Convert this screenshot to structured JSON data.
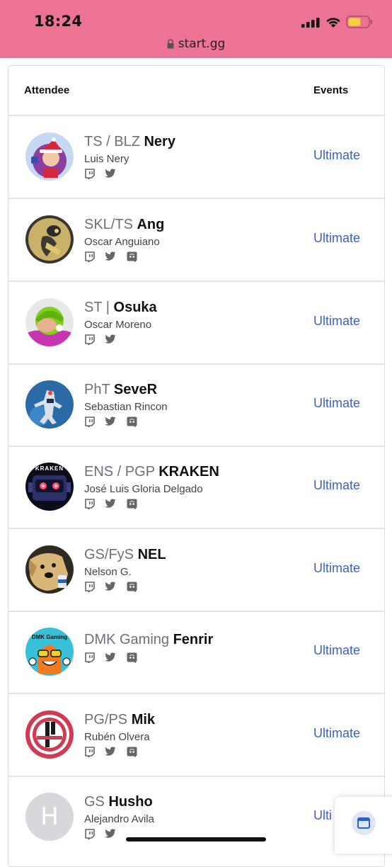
{
  "status_bar": {
    "time": "18:24",
    "url": "start.gg",
    "colors": {
      "background": "#ec7393",
      "battery": "#f5d037"
    }
  },
  "table": {
    "header": {
      "attendee": "Attendee",
      "events": "Events"
    },
    "rows": [
      {
        "prefix": "TS / BLZ",
        "tag": "Nery",
        "name": "Luis Nery",
        "socials": [
          "twitch-icon",
          "twitter-icon"
        ],
        "event": "Ultimate",
        "avatar": "avatar-santa-character"
      },
      {
        "prefix": "SKL/TS",
        "tag": "Ang",
        "name": "Oscar Anguiano",
        "socials": [
          "twitch-icon",
          "twitter-icon",
          "discord-icon"
        ],
        "event": "Ultimate",
        "avatar": "avatar-yellow-figure"
      },
      {
        "prefix": "ST |",
        "tag": "Osuka",
        "name": "Oscar Moreno",
        "socials": [
          "twitch-icon",
          "twitter-icon"
        ],
        "event": "Ultimate",
        "avatar": "avatar-green-hood"
      },
      {
        "prefix": "PhT",
        "tag": "SeveR",
        "name": "Sebastian Rincon",
        "socials": [
          "twitch-icon",
          "twitter-icon",
          "discord-icon"
        ],
        "event": "Ultimate",
        "avatar": "avatar-blue-mecha"
      },
      {
        "prefix": "ENS / PGP",
        "tag": "KRAKEN",
        "name": "José Luis Gloria Delgado",
        "socials": [
          "twitch-icon",
          "twitter-icon",
          "discord-icon"
        ],
        "event": "Ultimate",
        "avatar": "avatar-kraken-robot",
        "avatar_text": "KRAKEN"
      },
      {
        "prefix": "GS/FyS",
        "tag": "NEL",
        "name": "Nelson G.",
        "socials": [
          "twitch-icon",
          "twitter-icon",
          "discord-icon"
        ],
        "event": "Ultimate",
        "avatar": "avatar-dog"
      },
      {
        "prefix": "DMK Gaming",
        "tag": "Fenrir",
        "name": "",
        "socials": [
          "twitch-icon",
          "twitter-icon",
          "discord-icon"
        ],
        "event": "Ultimate",
        "avatar": "avatar-dmk-gaming",
        "avatar_text": "DMK Gaming"
      },
      {
        "prefix": "PG/PS",
        "tag": "Mik",
        "name": "Rubén Olvera",
        "socials": [
          "twitch-icon",
          "twitter-icon",
          "discord-icon"
        ],
        "event": "Ultimate",
        "avatar": "avatar-smash-logo"
      },
      {
        "prefix": "GS",
        "tag": "Husho",
        "name": "Alejandro Avila",
        "socials": [
          "twitch-icon",
          "twitter-icon"
        ],
        "event": "Ulti",
        "avatar": "avatar-letter",
        "avatar_letter": "H"
      }
    ]
  },
  "colors": {
    "event_link": "#3e61c0",
    "prefix": "#6b7079",
    "divider": "#e2e3e7"
  }
}
